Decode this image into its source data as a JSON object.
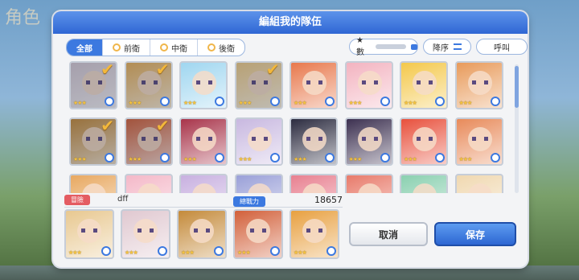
{
  "background": {
    "logo_text": "角色"
  },
  "dialog": {
    "title": "編組我的隊伍"
  },
  "filter_tabs": [
    {
      "label": "全部",
      "active": true
    },
    {
      "label": "前衛",
      "active": false
    },
    {
      "label": "中衛",
      "active": false
    },
    {
      "label": "後衛",
      "active": false
    }
  ],
  "sort": {
    "field_label": "★數",
    "order_label": "降序",
    "call_label": "呼叫"
  },
  "roster": [
    {
      "stars": "★★★",
      "checked": true,
      "color": "#d6c9d4"
    },
    {
      "stars": "★★★",
      "checked": true,
      "color": "#e8b05a"
    },
    {
      "stars": "★★★",
      "checked": false,
      "color": "#9fd6f0"
    },
    {
      "stars": "★★★",
      "checked": true,
      "color": "#f0cc88"
    },
    {
      "stars": "★★★",
      "checked": false,
      "color": "#e8784c"
    },
    {
      "stars": "★★★",
      "checked": false,
      "color": "#f3b3c0"
    },
    {
      "stars": "★★★",
      "checked": false,
      "color": "#f4c84a"
    },
    {
      "stars": "★★★",
      "checked": false,
      "color": "#e89a5a"
    },
    {
      "stars": "★★★",
      "checked": true,
      "color": "#c48a3a"
    },
    {
      "stars": "★★★",
      "checked": true,
      "color": "#d2603a"
    },
    {
      "stars": "★★★",
      "checked": false,
      "color": "#a8344a"
    },
    {
      "stars": "★★★",
      "checked": false,
      "color": "#c8b8e0"
    },
    {
      "stars": "★★★",
      "checked": false,
      "color": "#2c2c40"
    },
    {
      "stars": "★★★",
      "checked": false,
      "color": "#3c3050"
    },
    {
      "stars": "★★★",
      "checked": false,
      "color": "#e8503c"
    },
    {
      "stars": "★★★",
      "checked": false,
      "color": "#e88a5a"
    },
    {
      "stars": "",
      "checked": false,
      "color": "#e8a860"
    },
    {
      "stars": "",
      "checked": false,
      "color": "#f4b8c8"
    },
    {
      "stars": "",
      "checked": false,
      "color": "#c8b0e0"
    },
    {
      "stars": "",
      "checked": false,
      "color": "#9aa0d8"
    },
    {
      "stars": "",
      "checked": false,
      "color": "#e88090"
    },
    {
      "stars": "",
      "checked": false,
      "color": "#e87a6a"
    },
    {
      "stars": "",
      "checked": false,
      "color": "#8ad0b0"
    },
    {
      "stars": "",
      "checked": false,
      "color": "#f0d8b0"
    }
  ],
  "party": {
    "mode_tag": "冒險",
    "name": "dff",
    "power_label": "總戰力",
    "power_value": "18657",
    "members": [
      {
        "stars": "★★★",
        "color": "#e8c890"
      },
      {
        "stars": "★★★",
        "color": "#e0c8d0"
      },
      {
        "stars": "★★★",
        "color": "#c48a3a"
      },
      {
        "stars": "★★★",
        "color": "#d2603a"
      },
      {
        "stars": "★★★",
        "color": "#e8a040"
      }
    ]
  },
  "buttons": {
    "cancel": "取消",
    "save": "保存"
  }
}
